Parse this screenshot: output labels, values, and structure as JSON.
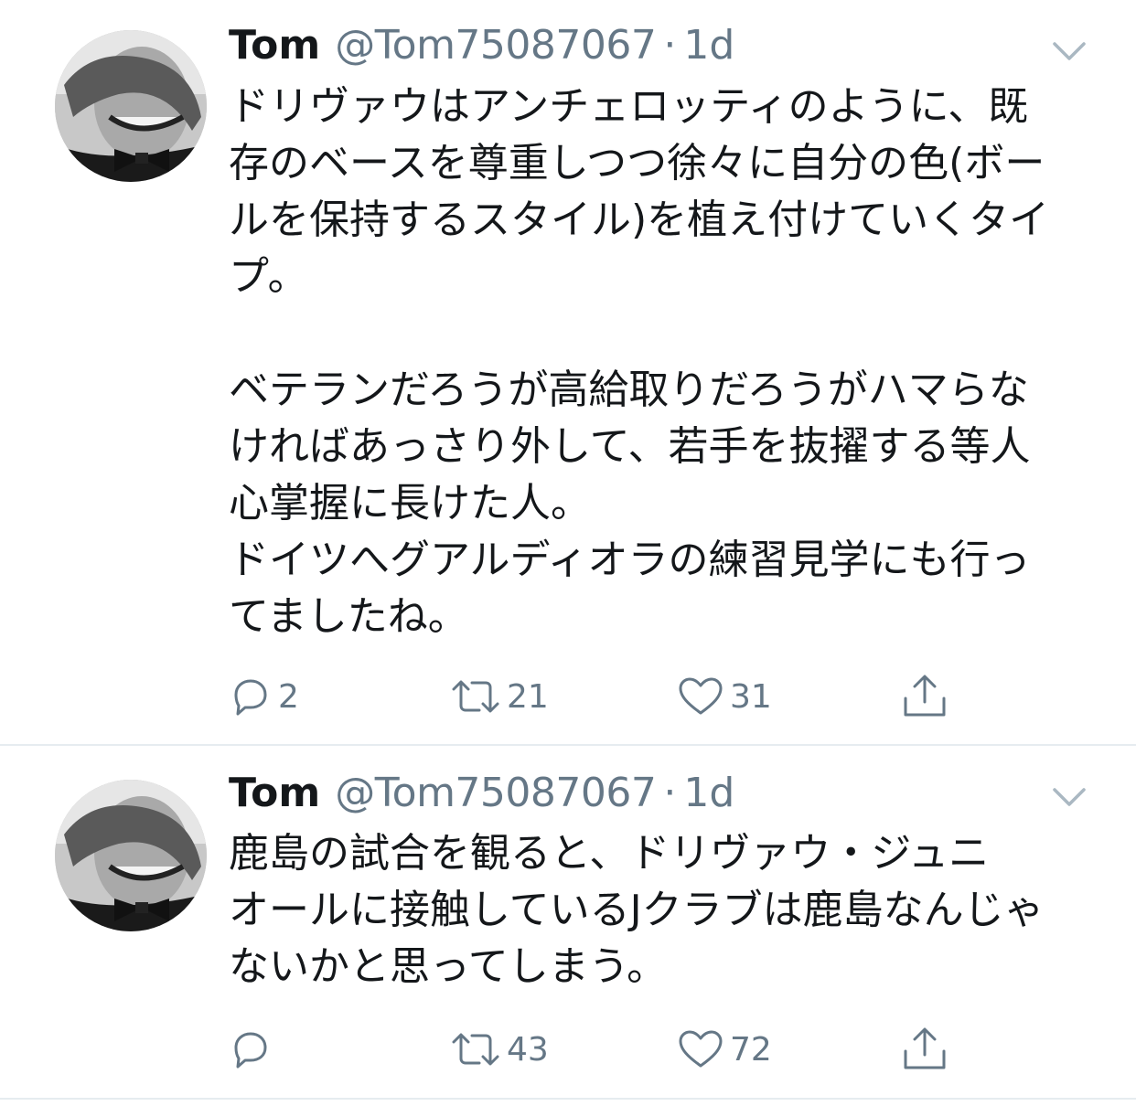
{
  "tweets": [
    {
      "name": "Tom",
      "handle": "@Tom75087067",
      "separator": "·",
      "time": "1d",
      "body_lines": [
        "ドリヴァウはアンチェロッティのように、既",
        "存のベースを尊重しつつ徐々に自分の色(ボー",
        "ルを保持するスタイル)を植え付けていくタイ",
        "プ。",
        "",
        "ベテランだろうが高給取りだろうがハマらな",
        "ければあっさり外して、若手を抜擢する等人",
        "心掌握に長けた人。",
        "ドイツへグアルディオラの練習見学にも行っ",
        "てましたね。"
      ],
      "actions": {
        "replies": "2",
        "retweets": "21",
        "likes": "31"
      }
    },
    {
      "name": "Tom",
      "handle": "@Tom75087067",
      "separator": "·",
      "time": "1d",
      "body_lines": [
        "鹿島の試合を観ると、ドリヴァウ・ジュニ",
        "オールに接触しているJクラブは鹿島なんじゃ",
        "ないかと思ってしまう。"
      ],
      "actions": {
        "replies": "",
        "retweets": "43",
        "likes": "72"
      }
    }
  ],
  "icons": {
    "avatar": "profile-photo-bw",
    "caret": "chevron-down-icon",
    "reply": "reply-icon",
    "retweet": "retweet-icon",
    "like": "heart-icon",
    "share": "share-icon"
  },
  "colors": {
    "text": "#14171a",
    "secondary": "#657786",
    "divider": "#e6ecf0",
    "caret": "#aab8c2"
  }
}
